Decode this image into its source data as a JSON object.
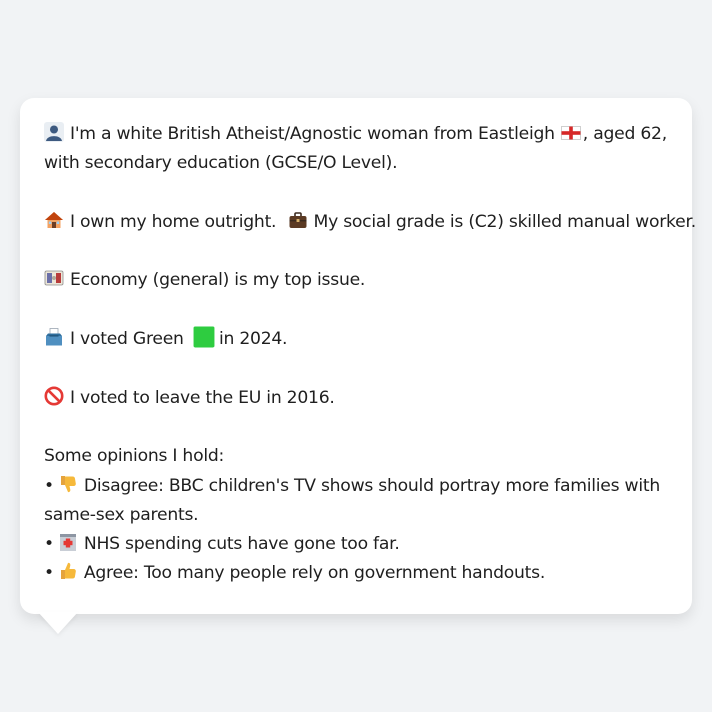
{
  "card": {
    "intro_line1_a": "I'm a white British Atheist/Agnostic woman from Eastleigh",
    "intro_line1_b": ", aged 62,",
    "intro_line2": "with secondary education (GCSE/O Level).",
    "home_text": "I own my home outright.",
    "grade_text": "My social grade is (C2) skilled manual worker.",
    "issue_text": "Economy (general) is my top issue.",
    "vote_text_a": "I voted Green",
    "vote_text_b": "in 2024.",
    "eu_text": "I voted to leave the EU in 2016.",
    "opinions_heading": "Some opinions I hold:",
    "opinion1_line1": "Disagree: BBC children's TV shows should portray more families with",
    "opinion1_line2": "same-sex parents.",
    "opinion2": "NHS spending cuts have gone too far.",
    "opinion3": "Agree: Too many people rely on government handouts.",
    "bullet": "•"
  },
  "icons": {
    "person": "person-icon",
    "flag": "england-flag-icon",
    "house": "house-icon",
    "briefcase": "briefcase-icon",
    "money": "banknote-icon",
    "ballot": "ballot-box-icon",
    "green": "green-square-icon",
    "no_entry": "prohibited-icon",
    "thumbs_down": "thumbs-down-icon",
    "hospital": "hospital-icon",
    "thumbs_up": "thumbs-up-icon"
  },
  "colors": {
    "background": "#f1f3f5",
    "card": "#ffffff",
    "text": "#1f1f1f",
    "green": "#2ecc40"
  }
}
